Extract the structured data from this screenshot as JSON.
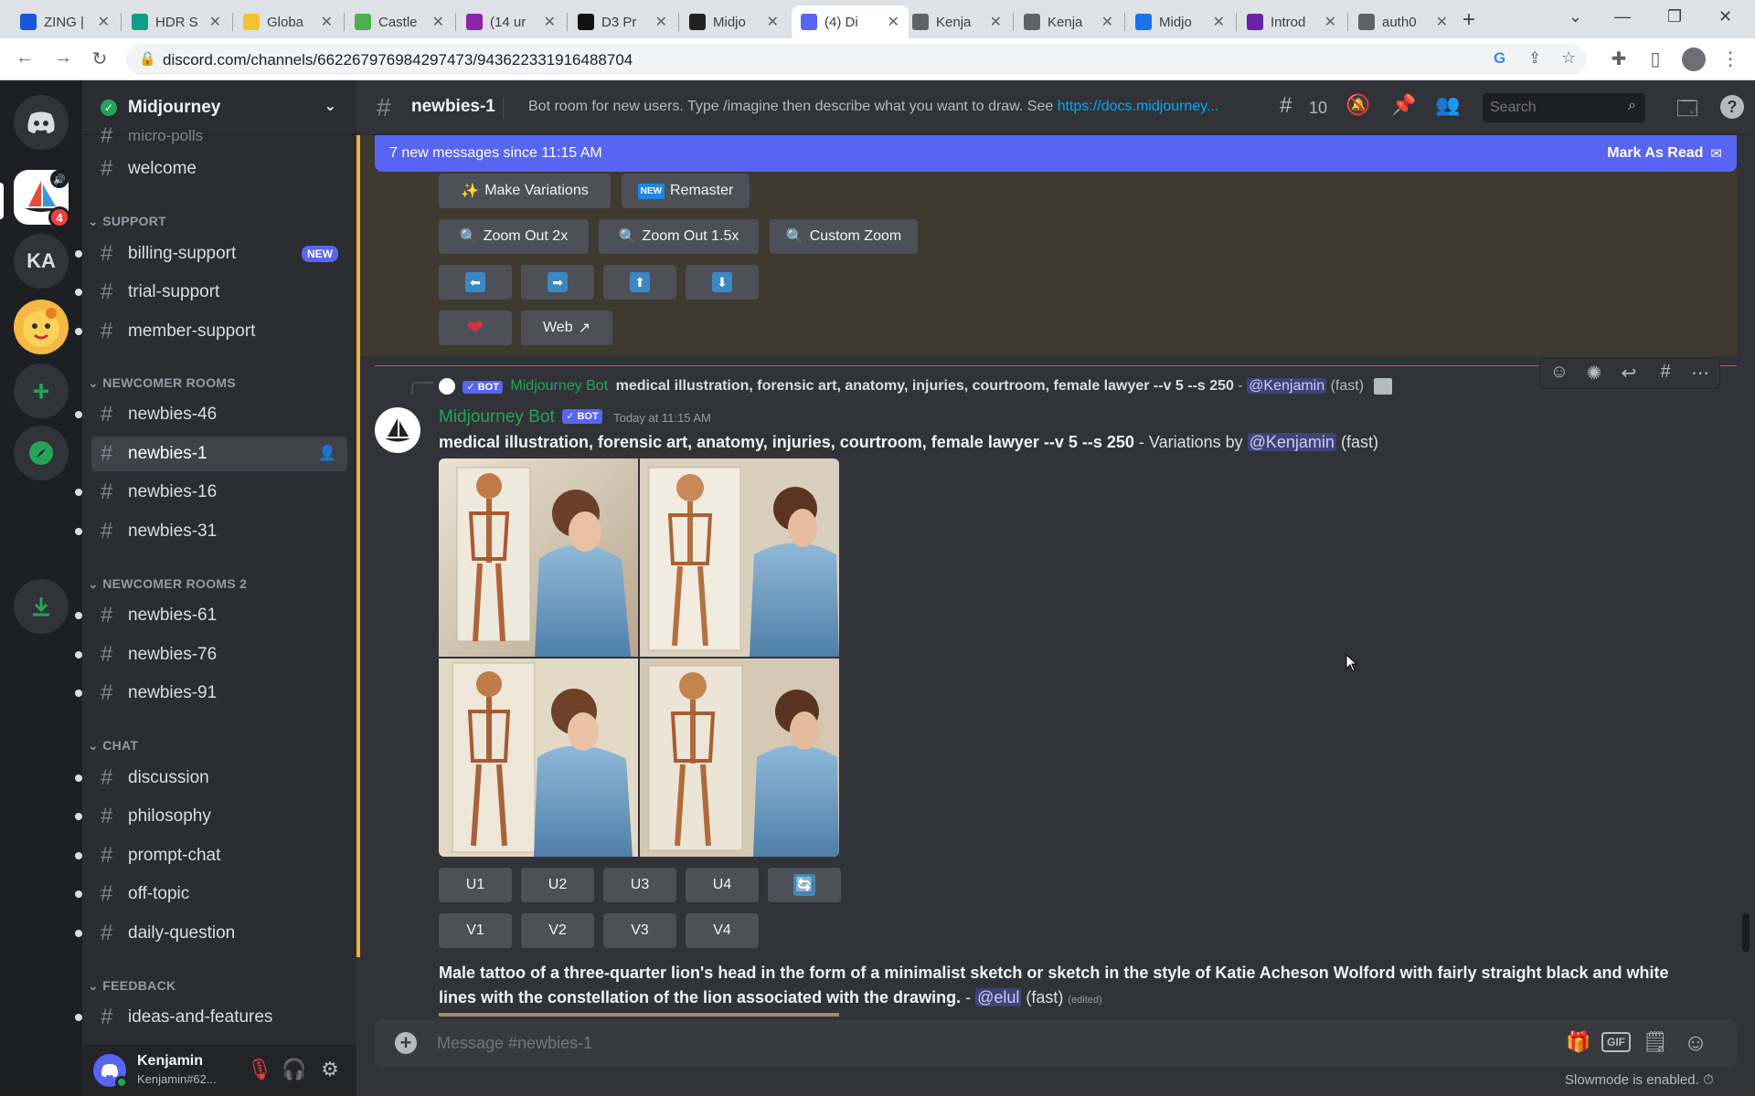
{
  "browser": {
    "tabs": [
      {
        "label": "ZING |",
        "color": "#1a56db"
      },
      {
        "label": "HDR S",
        "color": "#0f9d8a"
      },
      {
        "label": "Globa",
        "color": "#f2c230"
      },
      {
        "label": "Castle",
        "color": "#4caf50"
      },
      {
        "label": "(14 ur",
        "color": "#8e24aa"
      },
      {
        "label": "D3 Pr",
        "color": "#111111"
      },
      {
        "label": "Midjo",
        "color": "#222222"
      },
      {
        "label": "(4) Di",
        "color": "#5865f2",
        "active": true
      },
      {
        "label": "Kenja",
        "color": "#5f6368"
      },
      {
        "label": "Kenja",
        "color": "#5f6368"
      },
      {
        "label": "Midjo",
        "color": "#1a73e8"
      },
      {
        "label": "Introd",
        "color": "#6b21a8"
      },
      {
        "label": "auth0",
        "color": "#5f6368"
      }
    ],
    "url": "discord.com/channels/662267976984297473/943622331916488704"
  },
  "server": {
    "name": "Midjourney",
    "categories": {
      "support": "SUPPORT",
      "newcomer": "NEWCOMER ROOMS",
      "newcomer2": "NEWCOMER ROOMS 2",
      "chat": "CHAT",
      "feedback": "FEEDBACK"
    },
    "partial_channel": "micro-polls",
    "channels": {
      "welcome": "welcome",
      "billing": "billing-support",
      "new_badge": "NEW",
      "trial": "trial-support",
      "member": "member-support",
      "n46": "newbies-46",
      "n1": "newbies-1",
      "n16": "newbies-16",
      "n31": "newbies-31",
      "n61": "newbies-61",
      "n76": "newbies-76",
      "n91": "newbies-91",
      "discussion": "discussion",
      "philosophy": "philosophy",
      "prompt": "prompt-chat",
      "offtopic": "off-topic",
      "daily": "daily-question",
      "ideas": "ideas-and-features"
    },
    "guild_ka": "KA",
    "guild_badge": "4"
  },
  "user": {
    "name": "Kenjamin",
    "tag": "Kenjamin#62..."
  },
  "header": {
    "channel": "newbies-1",
    "topic": "Bot room for new users. Type /imagine then describe what you want to draw. See ",
    "topic_link": "https://docs.midjourney...",
    "threads": "10",
    "search_placeholder": "Search"
  },
  "banner": {
    "text": "7 new messages since 11:15 AM",
    "action": "Mark As Read"
  },
  "buttons_top": {
    "make_variations": "Make Variations",
    "remaster": "Remaster",
    "new_tag": "NEW",
    "zoom2": "Zoom Out 2x",
    "zoom15": "Zoom Out 1.5x",
    "custom_zoom": "Custom Zoom",
    "web": "Web"
  },
  "message": {
    "reply_author": "Midjourney Bot",
    "reply_text": "medical illustration, forensic art, anatomy, injuries, courtroom, female lawyer --v 5 --s 250",
    "reply_mention": "@Kenjamin",
    "reply_suffix": "(fast)",
    "bot_tag": "BOT",
    "author": "Midjourney Bot",
    "timestamp": "Today at 11:15 AM",
    "prompt": "medical illustration, forensic art, anatomy, injuries, courtroom, female lawyer --v 5 --s 250",
    "variations": " - Variations by ",
    "mention": "@Kenjamin",
    "speed": "(fast)",
    "upscale": [
      "U1",
      "U2",
      "U3",
      "U4"
    ],
    "variation": [
      "V1",
      "V2",
      "V3",
      "V4"
    ]
  },
  "next_message": {
    "prompt": "Male tattoo of a three-quarter lion's head in the form of a minimalist sketch or sketch in the style of Katie Acheson Wolford with fairly straight black and white lines with the constellation of the lion associated with the drawing.",
    "sep": " - ",
    "mention": "@elul",
    "speed": "(fast)",
    "edited": "(edited)"
  },
  "composer": {
    "placeholder": "Message #newbies-1",
    "gif": "GIF",
    "slowmode": "Slowmode is enabled."
  }
}
